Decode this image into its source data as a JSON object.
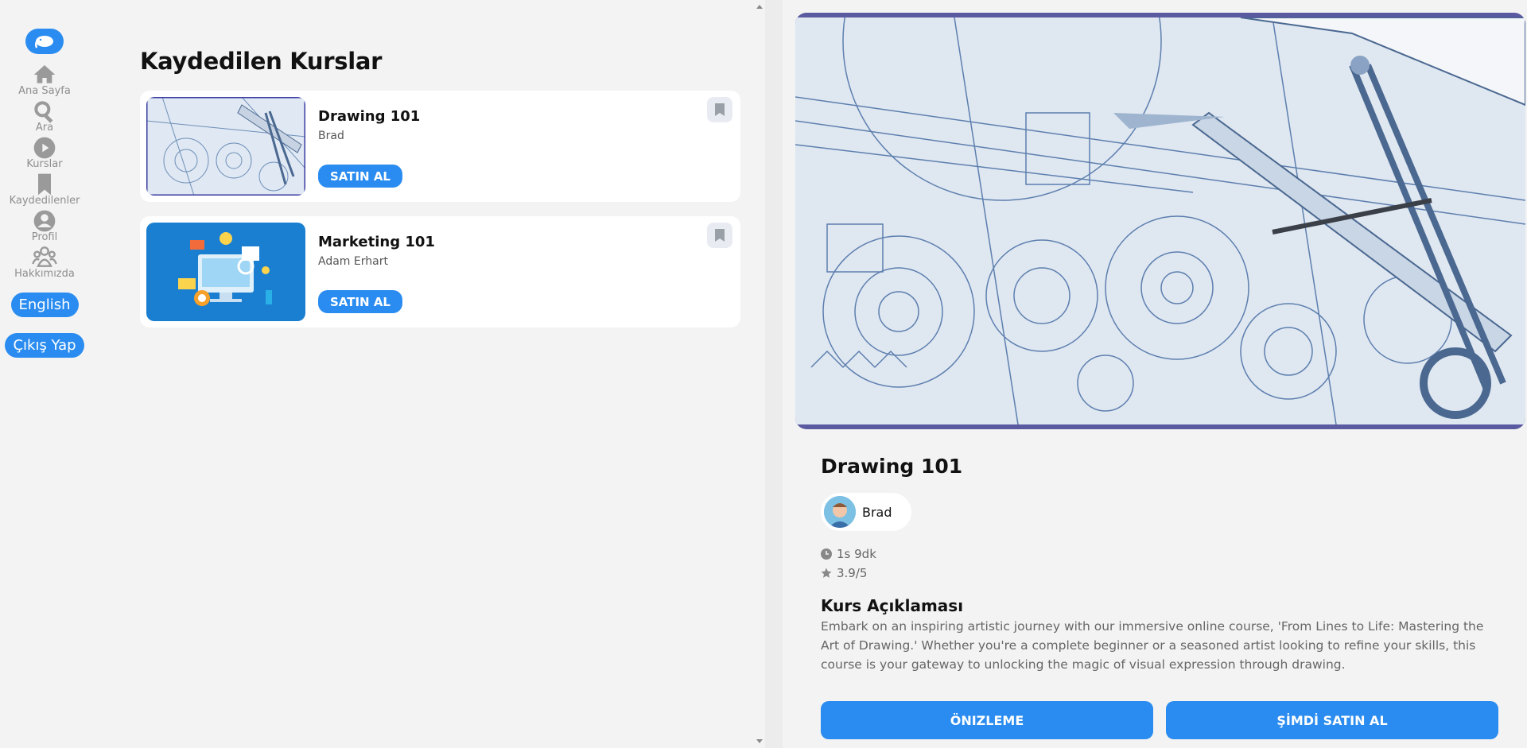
{
  "sidebar": {
    "logo_icon": "elephant-icon",
    "items": [
      {
        "label": "Ana Sayfa",
        "icon": "home-icon"
      },
      {
        "label": "Ara",
        "icon": "search-icon"
      },
      {
        "label": "Kurslar",
        "icon": "play-circle-icon"
      },
      {
        "label": "Kaydedilenler",
        "icon": "bookmark-icon"
      },
      {
        "label": "Profil",
        "icon": "user-icon"
      },
      {
        "label": "Hakkımızda",
        "icon": "group-icon"
      }
    ],
    "language_label": "English",
    "logout_label": "Çıkış Yap"
  },
  "main": {
    "title": "Kaydedilen Kurslar",
    "courses": [
      {
        "title": "Drawing 101",
        "author": "Brad",
        "buy_label": "SATIN AL"
      },
      {
        "title": "Marketing 101",
        "author": "Adam Erhart",
        "buy_label": "SATIN AL"
      }
    ]
  },
  "detail": {
    "title": "Drawing 101",
    "author": "Brad",
    "duration": "1s 9dk",
    "rating": "3.9/5",
    "description_heading": "Kurs Açıklaması",
    "description": "Embark on an inspiring artistic journey with our immersive online course, 'From Lines to Life: Mastering the Art of Drawing.' Whether you're a complete beginner or a seasoned artist looking to refine your skills, this course is your gateway to unlocking the magic of visual expression through drawing.",
    "preview_label": "ÖNIZLEME",
    "buy_now_label": "ŞİMDİ SATIN AL"
  },
  "colors": {
    "accent": "#2a8cf0",
    "background": "#f3f3f3",
    "hero_border": "#5a5aa0"
  }
}
